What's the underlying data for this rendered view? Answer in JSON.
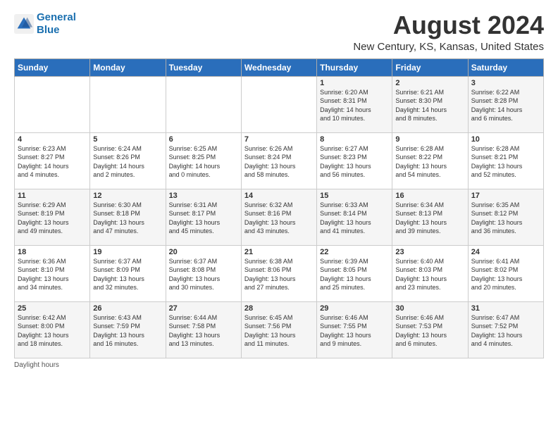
{
  "logo": {
    "line1": "General",
    "line2": "Blue"
  },
  "title": "August 2024",
  "location": "New Century, KS, Kansas, United States",
  "days_of_week": [
    "Sunday",
    "Monday",
    "Tuesday",
    "Wednesday",
    "Thursday",
    "Friday",
    "Saturday"
  ],
  "footer": "Daylight hours",
  "weeks": [
    [
      {
        "day": "",
        "info": ""
      },
      {
        "day": "",
        "info": ""
      },
      {
        "day": "",
        "info": ""
      },
      {
        "day": "",
        "info": ""
      },
      {
        "day": "1",
        "info": "Sunrise: 6:20 AM\nSunset: 8:31 PM\nDaylight: 14 hours\nand 10 minutes."
      },
      {
        "day": "2",
        "info": "Sunrise: 6:21 AM\nSunset: 8:30 PM\nDaylight: 14 hours\nand 8 minutes."
      },
      {
        "day": "3",
        "info": "Sunrise: 6:22 AM\nSunset: 8:28 PM\nDaylight: 14 hours\nand 6 minutes."
      }
    ],
    [
      {
        "day": "4",
        "info": "Sunrise: 6:23 AM\nSunset: 8:27 PM\nDaylight: 14 hours\nand 4 minutes."
      },
      {
        "day": "5",
        "info": "Sunrise: 6:24 AM\nSunset: 8:26 PM\nDaylight: 14 hours\nand 2 minutes."
      },
      {
        "day": "6",
        "info": "Sunrise: 6:25 AM\nSunset: 8:25 PM\nDaylight: 14 hours\nand 0 minutes."
      },
      {
        "day": "7",
        "info": "Sunrise: 6:26 AM\nSunset: 8:24 PM\nDaylight: 13 hours\nand 58 minutes."
      },
      {
        "day": "8",
        "info": "Sunrise: 6:27 AM\nSunset: 8:23 PM\nDaylight: 13 hours\nand 56 minutes."
      },
      {
        "day": "9",
        "info": "Sunrise: 6:28 AM\nSunset: 8:22 PM\nDaylight: 13 hours\nand 54 minutes."
      },
      {
        "day": "10",
        "info": "Sunrise: 6:28 AM\nSunset: 8:21 PM\nDaylight: 13 hours\nand 52 minutes."
      }
    ],
    [
      {
        "day": "11",
        "info": "Sunrise: 6:29 AM\nSunset: 8:19 PM\nDaylight: 13 hours\nand 49 minutes."
      },
      {
        "day": "12",
        "info": "Sunrise: 6:30 AM\nSunset: 8:18 PM\nDaylight: 13 hours\nand 47 minutes."
      },
      {
        "day": "13",
        "info": "Sunrise: 6:31 AM\nSunset: 8:17 PM\nDaylight: 13 hours\nand 45 minutes."
      },
      {
        "day": "14",
        "info": "Sunrise: 6:32 AM\nSunset: 8:16 PM\nDaylight: 13 hours\nand 43 minutes."
      },
      {
        "day": "15",
        "info": "Sunrise: 6:33 AM\nSunset: 8:14 PM\nDaylight: 13 hours\nand 41 minutes."
      },
      {
        "day": "16",
        "info": "Sunrise: 6:34 AM\nSunset: 8:13 PM\nDaylight: 13 hours\nand 39 minutes."
      },
      {
        "day": "17",
        "info": "Sunrise: 6:35 AM\nSunset: 8:12 PM\nDaylight: 13 hours\nand 36 minutes."
      }
    ],
    [
      {
        "day": "18",
        "info": "Sunrise: 6:36 AM\nSunset: 8:10 PM\nDaylight: 13 hours\nand 34 minutes."
      },
      {
        "day": "19",
        "info": "Sunrise: 6:37 AM\nSunset: 8:09 PM\nDaylight: 13 hours\nand 32 minutes."
      },
      {
        "day": "20",
        "info": "Sunrise: 6:37 AM\nSunset: 8:08 PM\nDaylight: 13 hours\nand 30 minutes."
      },
      {
        "day": "21",
        "info": "Sunrise: 6:38 AM\nSunset: 8:06 PM\nDaylight: 13 hours\nand 27 minutes."
      },
      {
        "day": "22",
        "info": "Sunrise: 6:39 AM\nSunset: 8:05 PM\nDaylight: 13 hours\nand 25 minutes."
      },
      {
        "day": "23",
        "info": "Sunrise: 6:40 AM\nSunset: 8:03 PM\nDaylight: 13 hours\nand 23 minutes."
      },
      {
        "day": "24",
        "info": "Sunrise: 6:41 AM\nSunset: 8:02 PM\nDaylight: 13 hours\nand 20 minutes."
      }
    ],
    [
      {
        "day": "25",
        "info": "Sunrise: 6:42 AM\nSunset: 8:00 PM\nDaylight: 13 hours\nand 18 minutes."
      },
      {
        "day": "26",
        "info": "Sunrise: 6:43 AM\nSunset: 7:59 PM\nDaylight: 13 hours\nand 16 minutes."
      },
      {
        "day": "27",
        "info": "Sunrise: 6:44 AM\nSunset: 7:58 PM\nDaylight: 13 hours\nand 13 minutes."
      },
      {
        "day": "28",
        "info": "Sunrise: 6:45 AM\nSunset: 7:56 PM\nDaylight: 13 hours\nand 11 minutes."
      },
      {
        "day": "29",
        "info": "Sunrise: 6:46 AM\nSunset: 7:55 PM\nDaylight: 13 hours\nand 9 minutes."
      },
      {
        "day": "30",
        "info": "Sunrise: 6:46 AM\nSunset: 7:53 PM\nDaylight: 13 hours\nand 6 minutes."
      },
      {
        "day": "31",
        "info": "Sunrise: 6:47 AM\nSunset: 7:52 PM\nDaylight: 13 hours\nand 4 minutes."
      }
    ]
  ]
}
